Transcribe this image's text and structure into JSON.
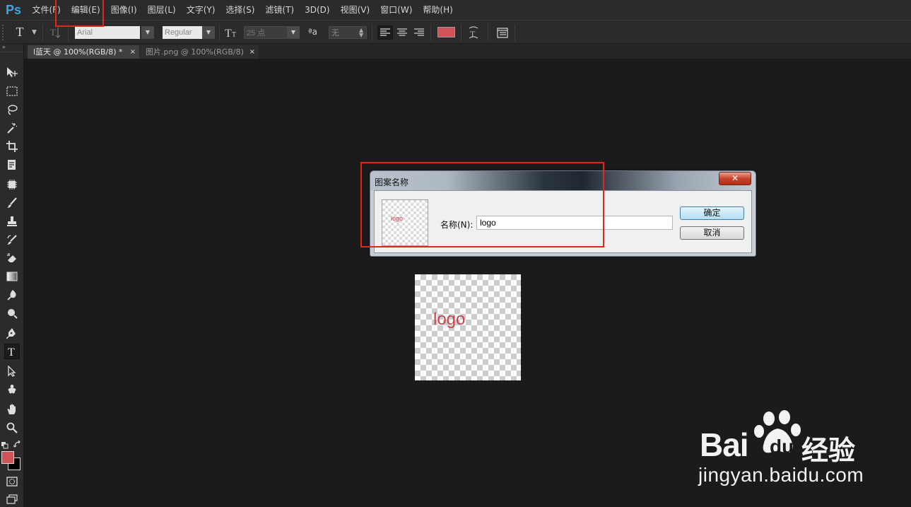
{
  "app": {
    "logo": "Ps"
  },
  "menu": [
    "文件(F)",
    "编辑(E)",
    "图像(I)",
    "图层(L)",
    "文字(Y)",
    "选择(S)",
    "滤镜(T)",
    "3D(D)",
    "视图(V)",
    "窗口(W)",
    "帮助(H)"
  ],
  "options": {
    "font_family": "Arial",
    "font_style": "Regular",
    "font_size": "25 点",
    "antialias_label": "ªa",
    "antialias": "无",
    "text_color": "#d05457"
  },
  "tabs": [
    {
      "label": "l蓝天 @ 100%(RGB/8) *",
      "close": "×"
    },
    {
      "label": "图片.png @ 100%(RGB/8)",
      "close": "×"
    }
  ],
  "toolbar": {
    "foreground_color": "#d05457",
    "background_color": "#000000"
  },
  "document": {
    "text": "logo",
    "text_color": "#c9454c"
  },
  "dialog": {
    "title": "图案名称",
    "close": "✕",
    "preview_text": "logo",
    "name_label": "名称(N):",
    "name_value": "logo",
    "ok_label": "确定",
    "cancel_label": "取消"
  },
  "watermark": {
    "brand_a": "Bai",
    "brand_b": "du",
    "brand_c": "经验",
    "url": "jingyan.baidu.com"
  }
}
